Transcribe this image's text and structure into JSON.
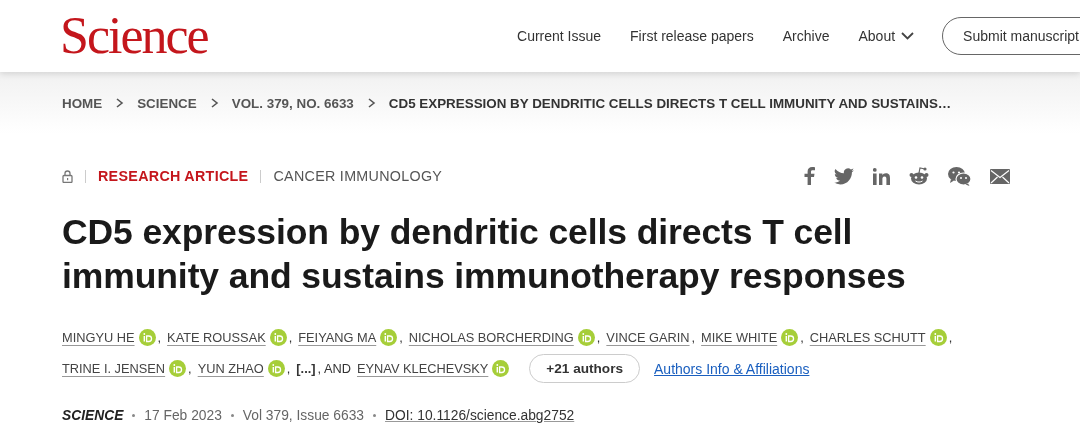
{
  "header": {
    "logo": "Science",
    "nav": [
      {
        "label": "Current Issue",
        "kind": "link"
      },
      {
        "label": "First release papers",
        "kind": "link"
      },
      {
        "label": "Archive",
        "kind": "link"
      },
      {
        "label": "About",
        "kind": "dropdown"
      }
    ],
    "submit": "Submit manuscript"
  },
  "breadcrumb": [
    "HOME",
    "SCIENCE",
    "VOL. 379, NO. 6633",
    "CD5 EXPRESSION BY DENDRITIC CELLS DIRECTS T CELL IMMUNITY AND SUSTAINS…"
  ],
  "article": {
    "type": "RESEARCH ARTICLE",
    "topic": "CANCER IMMUNOLOGY",
    "title": "CD5 expression by dendritic cells directs T cell immunity and sustains immunotherapy responses",
    "author_lines": [
      [
        {
          "kind": "author",
          "name": "MINGYU HE",
          "orcid": true,
          "after": ","
        },
        {
          "kind": "author",
          "name": "KATE ROUSSAK",
          "orcid": true,
          "after": ","
        },
        {
          "kind": "author",
          "name": "FEIYANG MA",
          "orcid": true,
          "after": ","
        },
        {
          "kind": "author",
          "name": "NICHOLAS BORCHERDING",
          "orcid": true,
          "after": ","
        },
        {
          "kind": "author",
          "name": "VINCE GARIN",
          "orcid": false,
          "after": ","
        },
        {
          "kind": "author",
          "name": "MIKE WHITE",
          "orcid": true,
          "after": ","
        },
        {
          "kind": "author",
          "name": "CHARLES SCHUTT",
          "orcid": true,
          "after": ","
        }
      ],
      [
        {
          "kind": "author",
          "name": "TRINE I. JENSEN",
          "orcid": true,
          "after": ","
        },
        {
          "kind": "author",
          "name": "YUN ZHAO",
          "orcid": true,
          "after": ","
        },
        {
          "kind": "more",
          "name": "[...]",
          "after": ", AND"
        },
        {
          "kind": "author",
          "name": "EYNAV KLECHEVSKY",
          "orcid": true
        }
      ]
    ],
    "more_authors": "+21 authors",
    "affiliations": "Authors Info & Affiliations",
    "journal": "SCIENCE",
    "date": "17 Feb 2023",
    "volume": "Vol 379, Issue 6633",
    "doi": "DOI: 10.1126/science.abg2752"
  }
}
